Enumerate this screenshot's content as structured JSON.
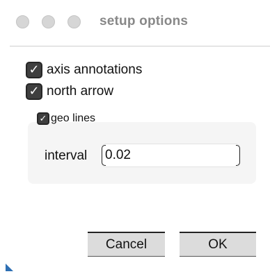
{
  "window": {
    "title": "setup options"
  },
  "options": {
    "axis_annotations": {
      "label": "axis annotations",
      "checked": true
    },
    "north_arrow": {
      "label": "north arrow",
      "checked": true
    },
    "geo_lines": {
      "label": "geo lines",
      "checked": true
    }
  },
  "interval": {
    "label": "interval",
    "value": "0.02"
  },
  "buttons": {
    "cancel": "Cancel",
    "ok": "OK"
  },
  "icons": {
    "check": "✓"
  },
  "colors": {
    "checkbox_fill": "#3f3f3f",
    "title_text": "#888888",
    "group_background": "#f5f5f5",
    "button_background": "#dcdcdc",
    "corner_accent": "#2d6fb3"
  }
}
